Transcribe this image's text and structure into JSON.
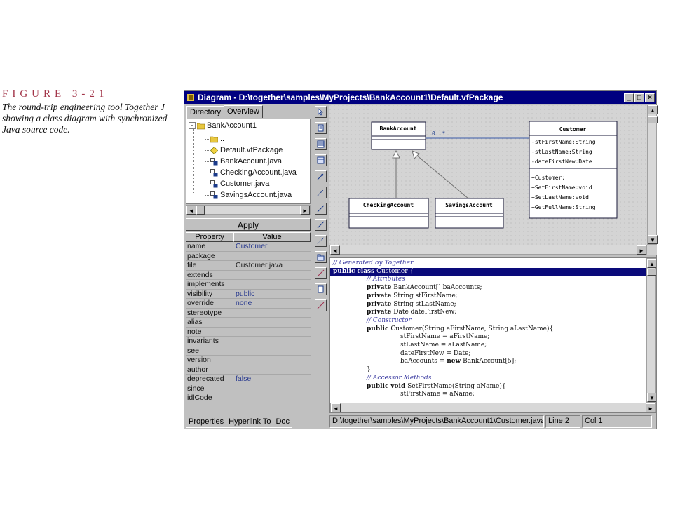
{
  "caption": {
    "figure": "FIGURE 3-21",
    "description": "The round-trip engineering tool Together J showing a class diagram with synchronized Java source code."
  },
  "window": {
    "title": "Diagram - D:\\together\\samples\\MyProjects\\BankAccount1\\Default.vfPackage",
    "controls": [
      "_",
      "□",
      "×"
    ]
  },
  "left_tabs": [
    "Directory",
    "Overview"
  ],
  "tree": {
    "root": "BankAccount1",
    "items": [
      {
        "label": "..",
        "icon": "folder-icon"
      },
      {
        "label": "Default.vfPackage",
        "icon": "package-icon"
      },
      {
        "label": "BankAccount.java",
        "icon": "java-file-icon"
      },
      {
        "label": "CheckingAccount.java",
        "icon": "java-file-icon"
      },
      {
        "label": "Customer.java",
        "icon": "java-file-icon"
      },
      {
        "label": "SavingsAccount.java",
        "icon": "java-file-icon"
      }
    ]
  },
  "apply_label": "Apply",
  "properties": {
    "headers": [
      "Property",
      "Value"
    ],
    "rows": [
      {
        "name": "name",
        "value": "Customer"
      },
      {
        "name": "package",
        "value": ""
      },
      {
        "name": "file",
        "value": "Customer.java"
      },
      {
        "name": "extends",
        "value": ""
      },
      {
        "name": "implements",
        "value": ""
      },
      {
        "name": "visibility",
        "value": "public"
      },
      {
        "name": "override",
        "value": "none"
      },
      {
        "name": "stereotype",
        "value": ""
      },
      {
        "name": "alias",
        "value": ""
      },
      {
        "name": "note",
        "value": ""
      },
      {
        "name": "invariants",
        "value": ""
      },
      {
        "name": "see",
        "value": ""
      },
      {
        "name": "version",
        "value": ""
      },
      {
        "name": "author",
        "value": ""
      },
      {
        "name": "deprecated",
        "value": "false"
      },
      {
        "name": "since",
        "value": ""
      },
      {
        "name": "idlCode",
        "value": ""
      }
    ]
  },
  "bottom_tabs": [
    "Properties",
    "Hyperlink To",
    "Doc"
  ],
  "diagram": {
    "classes": [
      {
        "name": "BankAccount",
        "attributes": [],
        "methods": []
      },
      {
        "name": "Customer",
        "attributes": [
          "-stFirstName:String",
          "-stLastName:String",
          "-dateFirstNew:Date"
        ],
        "methods": [
          "+Customer:",
          "+SetFirstName:void",
          "+SetLastName:void",
          "+GetFullName:String"
        ]
      },
      {
        "name": "CheckingAccount",
        "attributes": [],
        "methods": []
      },
      {
        "name": "SavingsAccount",
        "attributes": [],
        "methods": []
      }
    ],
    "multiplicity": "0..*"
  },
  "code_lines": [
    {
      "text": "// Generated by Together",
      "indent": 0,
      "kind": "comment"
    },
    {
      "text": "public class Customer {",
      "indent": 0,
      "kind": "highlight"
    },
    {
      "text": "// Attributes",
      "indent": 1,
      "kind": "comment"
    },
    {
      "text": "private BankAccount[] baAccounts;",
      "indent": 1,
      "kind": "code"
    },
    {
      "text": "private String stFirstName;",
      "indent": 1,
      "kind": "code"
    },
    {
      "text": "private String stLastName;",
      "indent": 1,
      "kind": "code"
    },
    {
      "text": "private Date dateFirstNew;",
      "indent": 1,
      "kind": "code"
    },
    {
      "text": "// Constructor",
      "indent": 1,
      "kind": "comment"
    },
    {
      "text": "public Customer(String aFirstName, String aLastName){",
      "indent": 1,
      "kind": "code"
    },
    {
      "text": "stFirstName = aFirstName;",
      "indent": 2,
      "kind": "code"
    },
    {
      "text": "stLastName = aLastName;",
      "indent": 2,
      "kind": "code"
    },
    {
      "text": "dateFirstNew = Date;",
      "indent": 2,
      "kind": "code"
    },
    {
      "text": "baAccounts = new BankAccount[5];",
      "indent": 2,
      "kind": "code"
    },
    {
      "text": "}",
      "indent": 1,
      "kind": "code"
    },
    {
      "text": "// Accessor Methods",
      "indent": 1,
      "kind": "comment"
    },
    {
      "text": "public void SetFirstName(String aName){",
      "indent": 1,
      "kind": "code"
    },
    {
      "text": "stFirstName = aName;",
      "indent": 2,
      "kind": "code"
    }
  ],
  "status": {
    "path": "D:\\together\\samples\\MyProjects\\BankAccount1\\Customer.java",
    "line": "Line 2",
    "col": "Col 1"
  }
}
